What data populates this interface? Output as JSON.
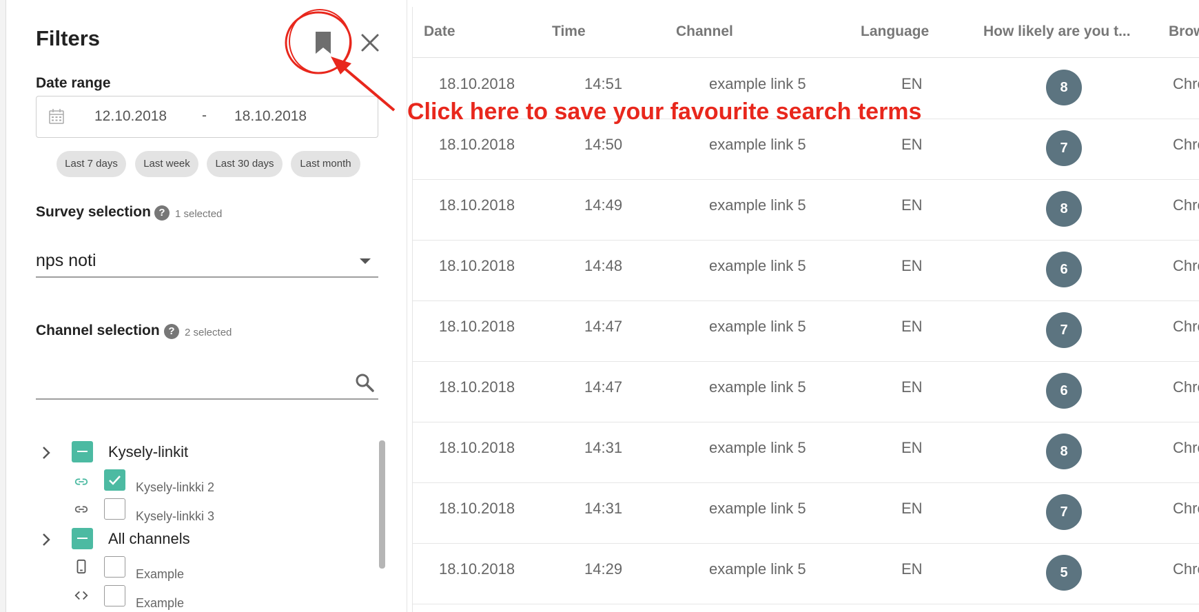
{
  "filters": {
    "title": "Filters",
    "bookmark_icon": "bookmark-icon",
    "close_icon": "close-icon",
    "date_range": {
      "label": "Date range",
      "from": "12.10.2018",
      "separator": "-",
      "to": "18.10.2018",
      "icon": "calendar-icon",
      "presets": [
        "Last 7 days",
        "Last week",
        "Last 30 days",
        "Last month"
      ]
    },
    "survey": {
      "label": "Survey selection",
      "help": "?",
      "count": "1 selected",
      "value": "nps noti"
    },
    "channel": {
      "label": "Channel selection",
      "help": "?",
      "count": "2 selected",
      "search_placeholder": "",
      "groups": [
        {
          "label": "Kysely-linkit",
          "items": [
            {
              "label": "Kysely-linkki 2",
              "icon": "link-icon",
              "checked": true
            },
            {
              "label": "Kysely-linkki 3",
              "icon": "link-icon",
              "checked": false
            }
          ]
        },
        {
          "label": "All channels",
          "items": [
            {
              "label": "Example",
              "icon": "mobile-icon",
              "checked": false
            },
            {
              "label": "Example",
              "icon": "code-icon",
              "checked": false
            }
          ]
        }
      ]
    }
  },
  "table": {
    "columns": [
      "Date",
      "Time",
      "Channel",
      "Language",
      "How likely are you t...",
      "Brow"
    ],
    "rows": [
      {
        "date": "18.10.2018",
        "time": "14:51",
        "channel": "example link 5",
        "language": "EN",
        "score": "8",
        "browser": "Chro"
      },
      {
        "date": "18.10.2018",
        "time": "14:50",
        "channel": "example link 5",
        "language": "EN",
        "score": "7",
        "browser": "Chro"
      },
      {
        "date": "18.10.2018",
        "time": "14:49",
        "channel": "example link 5",
        "language": "EN",
        "score": "8",
        "browser": "Chro"
      },
      {
        "date": "18.10.2018",
        "time": "14:48",
        "channel": "example link 5",
        "language": "EN",
        "score": "6",
        "browser": "Chro"
      },
      {
        "date": "18.10.2018",
        "time": "14:47",
        "channel": "example link 5",
        "language": "EN",
        "score": "7",
        "browser": "Chro"
      },
      {
        "date": "18.10.2018",
        "time": "14:47",
        "channel": "example link 5",
        "language": "EN",
        "score": "6",
        "browser": "Chro"
      },
      {
        "date": "18.10.2018",
        "time": "14:31",
        "channel": "example link 5",
        "language": "EN",
        "score": "8",
        "browser": "Chro"
      },
      {
        "date": "18.10.2018",
        "time": "14:31",
        "channel": "example link 5",
        "language": "EN",
        "score": "7",
        "browser": "Chro"
      },
      {
        "date": "18.10.2018",
        "time": "14:29",
        "channel": "example link 5",
        "language": "EN",
        "score": "5",
        "browser": "Chro"
      }
    ]
  },
  "annotation": {
    "text": "Click here to save your favourite search terms",
    "color": "#e8271c"
  },
  "colors": {
    "accent": "#4cbaa2",
    "score_badge": "#5c7480"
  }
}
